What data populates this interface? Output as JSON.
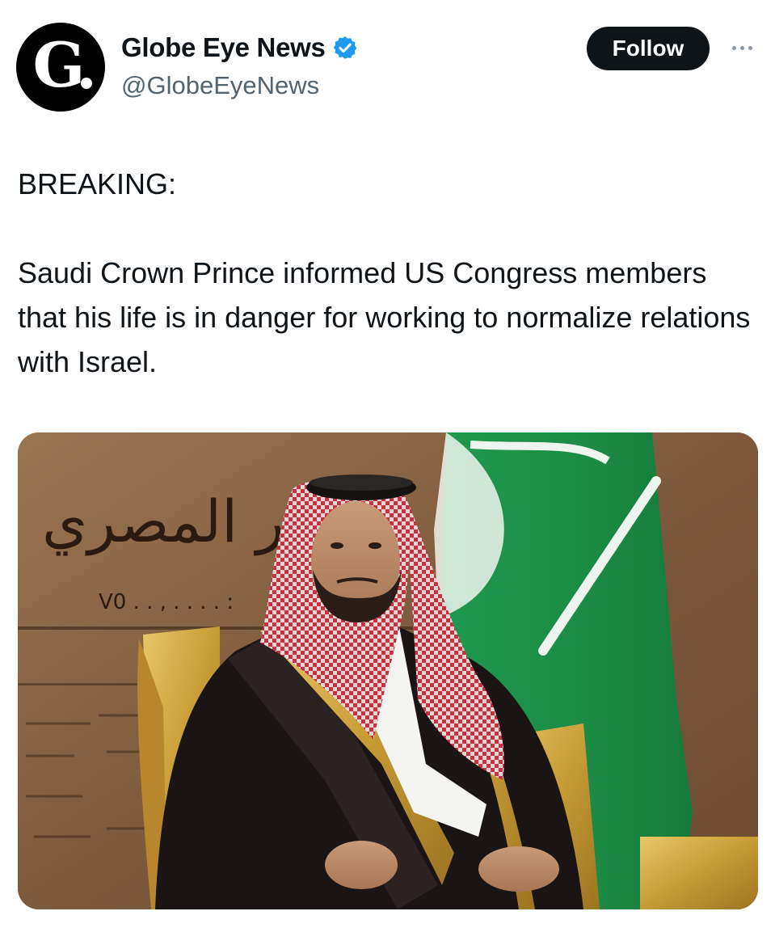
{
  "author": {
    "display_name": "Globe Eye News",
    "handle": "@GlobeEyeNews",
    "avatar_letter": "G",
    "verified": true,
    "verified_color": "#1d9bf0"
  },
  "actions": {
    "follow_label": "Follow",
    "more_icon": "more-horizontal-icon"
  },
  "tweet": {
    "lines": [
      "BREAKING:",
      "Saudi Crown Prince informed US Congress members that his life is in danger for working to normalize relations with Israel."
    ]
  },
  "media": {
    "wall_inscription": "الدر المصري",
    "wall_number": "V0 . . , . . . . :"
  }
}
